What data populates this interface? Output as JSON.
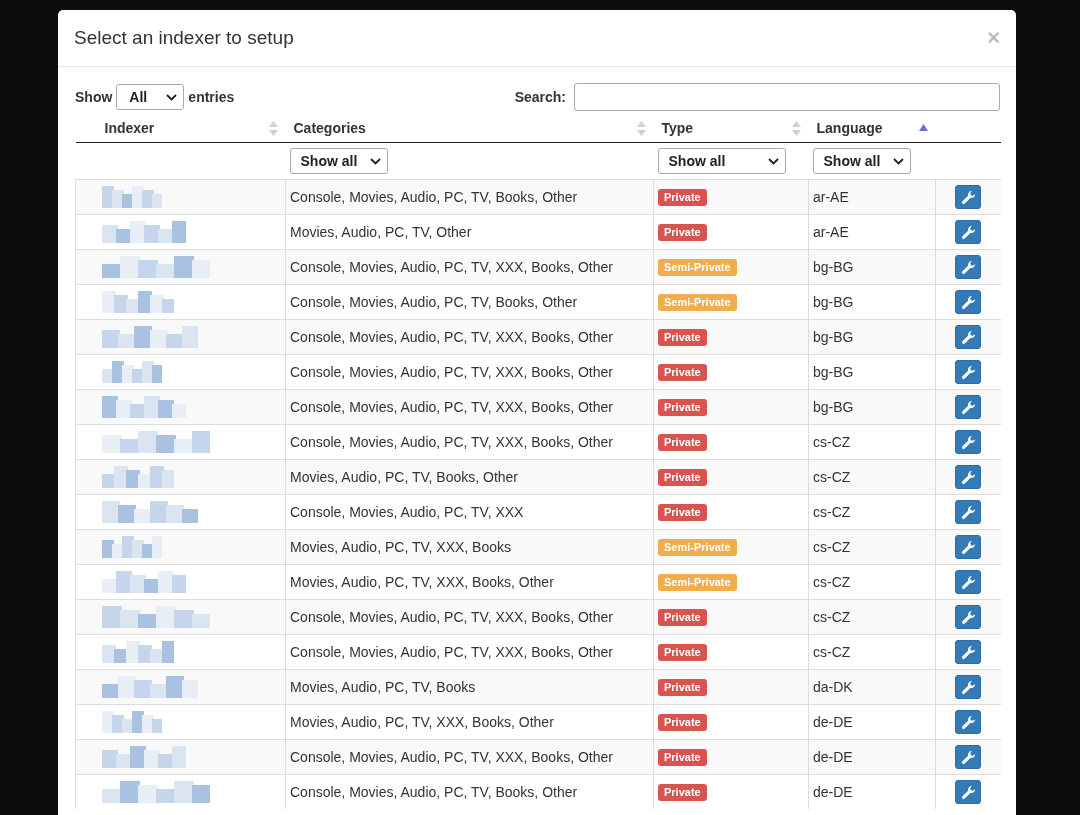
{
  "modal": {
    "title": "Select an indexer to setup",
    "close": "×"
  },
  "length": {
    "label_before": "Show",
    "value": "All",
    "label_after": "entries"
  },
  "search": {
    "label": "Search:"
  },
  "columns": [
    {
      "label": "Indexer",
      "sorted": false
    },
    {
      "label": "Categories",
      "sorted": false
    },
    {
      "label": "Type",
      "sorted": false
    },
    {
      "label": "Language",
      "sorted": true
    }
  ],
  "filters": [
    "Show all",
    "Show all",
    "Show all"
  ],
  "rows": [
    {
      "categories": "Console, Movies, Audio, PC, TV, Books, Other",
      "type": {
        "label": "Private",
        "kind": "private"
      },
      "language": "ar-AE"
    },
    {
      "categories": "Movies, Audio, PC, TV, Other",
      "type": {
        "label": "Private",
        "kind": "private"
      },
      "language": "ar-AE"
    },
    {
      "categories": "Console, Movies, Audio, PC, TV, XXX, Books, Other",
      "type": {
        "label": "Semi-Private",
        "kind": "semi"
      },
      "language": "bg-BG"
    },
    {
      "categories": "Console, Movies, Audio, PC, TV, Books, Other",
      "type": {
        "label": "Semi-Private",
        "kind": "semi"
      },
      "language": "bg-BG"
    },
    {
      "categories": "Console, Movies, Audio, PC, TV, XXX, Books, Other",
      "type": {
        "label": "Private",
        "kind": "private"
      },
      "language": "bg-BG"
    },
    {
      "categories": "Console, Movies, Audio, PC, TV, XXX, Books, Other",
      "type": {
        "label": "Private",
        "kind": "private"
      },
      "language": "bg-BG"
    },
    {
      "categories": "Console, Movies, Audio, PC, TV, XXX, Books, Other",
      "type": {
        "label": "Private",
        "kind": "private"
      },
      "language": "bg-BG"
    },
    {
      "categories": "Console, Movies, Audio, PC, TV, XXX, Books, Other",
      "type": {
        "label": "Private",
        "kind": "private"
      },
      "language": "cs-CZ"
    },
    {
      "categories": "Movies, Audio, PC, TV, Books, Other",
      "type": {
        "label": "Private",
        "kind": "private"
      },
      "language": "cs-CZ"
    },
    {
      "categories": "Console, Movies, Audio, PC, TV, XXX",
      "type": {
        "label": "Private",
        "kind": "private"
      },
      "language": "cs-CZ"
    },
    {
      "categories": "Movies, Audio, PC, TV, XXX, Books",
      "type": {
        "label": "Semi-Private",
        "kind": "semi"
      },
      "language": "cs-CZ"
    },
    {
      "categories": "Movies, Audio, PC, TV, XXX, Books, Other",
      "type": {
        "label": "Semi-Private",
        "kind": "semi"
      },
      "language": "cs-CZ"
    },
    {
      "categories": "Console, Movies, Audio, PC, TV, XXX, Books, Other",
      "type": {
        "label": "Private",
        "kind": "private"
      },
      "language": "cs-CZ"
    },
    {
      "categories": "Console, Movies, Audio, PC, TV, XXX, Books, Other",
      "type": {
        "label": "Private",
        "kind": "private"
      },
      "language": "cs-CZ"
    },
    {
      "categories": "Movies, Audio, PC, TV, Books",
      "type": {
        "label": "Private",
        "kind": "private"
      },
      "language": "da-DK"
    },
    {
      "categories": "Movies, Audio, PC, TV, XXX, Books, Other",
      "type": {
        "label": "Private",
        "kind": "private"
      },
      "language": "de-DE"
    },
    {
      "categories": "Console, Movies, Audio, PC, TV, XXX, Books, Other",
      "type": {
        "label": "Private",
        "kind": "private"
      },
      "language": "de-DE"
    },
    {
      "categories": "Console, Movies, Audio, PC, TV, Books, Other",
      "type": {
        "label": "Private",
        "kind": "private"
      },
      "language": "de-DE"
    }
  ]
}
